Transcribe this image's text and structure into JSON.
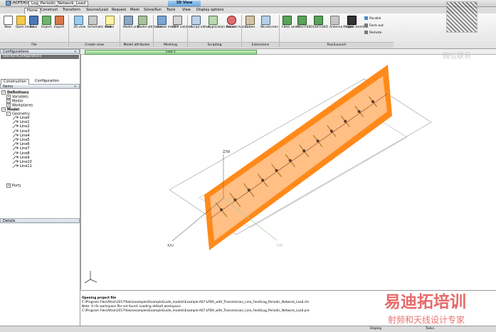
{
  "titlebar": {
    "app": "CADFEKO v2017",
    "document": "Log_Periodic_Network_Load"
  },
  "tabs": {
    "context": "3D View",
    "items": [
      "Home",
      "Construct",
      "Transform",
      "Source/Load",
      "Request",
      "Mesh",
      "Solve/Run",
      "Tools",
      "View",
      "Display options"
    ]
  },
  "ribbon": {
    "buttons": [
      {
        "label": "New",
        "icon": "new-icon"
      },
      {
        "label": "Open model",
        "icon": "open-icon"
      },
      {
        "label": "Save",
        "icon": "save-icon"
      },
      {
        "label": "Import",
        "icon": "import-icon"
      },
      {
        "label": "Export",
        "icon": "export-icon"
      },
      {
        "label": "3D view",
        "icon": "view3d-icon"
      },
      {
        "label": "Schematic view",
        "icon": "schematic-icon"
      },
      {
        "label": "Notes",
        "icon": "notes-icon"
      },
      {
        "label": "Model unit",
        "icon": "model-unit-icon"
      },
      {
        "label": "Model attributes",
        "icon": "model-attributes-icon"
      },
      {
        "label": "Create mesh",
        "icon": "create-mesh-icon"
      },
      {
        "label": "CEM validate",
        "icon": "cem-validate-icon"
      },
      {
        "label": "Script editor",
        "icon": "script-editor-icon"
      },
      {
        "label": "Application macro",
        "icon": "application-macro-icon"
      },
      {
        "label": "Record macro",
        "icon": "record-macro-icon"
      },
      {
        "label": "Cables",
        "icon": "cables-icon"
      },
      {
        "label": "Windscreen",
        "icon": "windscreen-icon"
      },
      {
        "label": "FEKO solver",
        "icon": "feko-solver-icon"
      },
      {
        "label": "POSTFEKO",
        "icon": "postfeko-icon"
      },
      {
        "label": "EDITFEKO",
        "icon": "editfeko-icon"
      },
      {
        "label": "Antenna Magus",
        "icon": "antenna-magus-icon"
      },
      {
        "label": "FEKO terminal",
        "icon": "feko-terminal-icon"
      }
    ],
    "side": [
      "Parallel",
      "Farm out",
      "Remote"
    ],
    "groups": [
      "File",
      "Create view",
      "Model attributes",
      "Meshing",
      "Scripting",
      "Extensions",
      "Run/Launch"
    ]
  },
  "configurations": {
    "title": "Configurations",
    "item": "StandardConfiguration1"
  },
  "panel_tabs": [
    "Construction",
    "Configuration"
  ],
  "tree": {
    "title": "Items",
    "definitions": "Definitions",
    "variables": "Variables",
    "media": "Media",
    "workplanes": "Workplanes",
    "model": "Model",
    "geometry": "Geometry",
    "lines": [
      "Line0",
      "Line1",
      "Line2",
      "Line3",
      "Line4",
      "Line5",
      "Line6",
      "Line7",
      "Line8",
      "Line9",
      "Line10",
      "Line11"
    ],
    "ports": "Ports"
  },
  "details": {
    "title": "Details"
  },
  "viewport": {
    "tab": "view 1",
    "axis_z": "Z/W",
    "axis_x": "X/U",
    "axis_y": "Y/V"
  },
  "messages": [
    "Opening project file",
    "C:\\Program Files\\Altair\\2017\\feko\\examples\\ExampleGuide_models\\Example-A07-LPDA_with_Transmission_Line_Feed\\Log_Periodic_Network_Load.cfx",
    "Note:   A cfx workspace file not found. Loading default workspace.",
    "C:\\Program Files\\Altair\\2017\\feko\\examples\\ExampleGuide_models\\Example-A07-LPDA_with_Transmission_Line_Feed\\Log_Periodic_Network_Load.pre"
  ],
  "status": {
    "item1": "Display",
    "item2": "Tasks"
  },
  "watermark": {
    "top": "微信联系",
    "brand": "易迪拓培训",
    "sub": "射频和天线设计专家"
  },
  "colors": {
    "accent": "#ff8a1a",
    "plate": "#ffb36b",
    "line": "#8a5a00"
  }
}
